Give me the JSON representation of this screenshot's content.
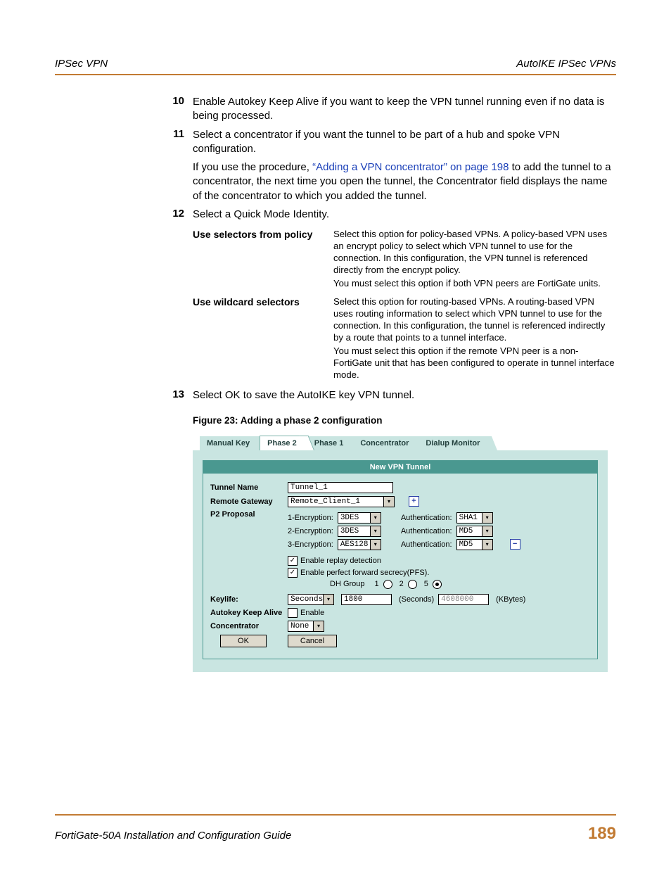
{
  "header": {
    "left": "IPSec VPN",
    "right": "AutoIKE IPSec VPNs"
  },
  "steps": {
    "s10": {
      "num": "10",
      "text": "Enable Autokey Keep Alive if you want to keep the VPN tunnel running even if no data is being processed."
    },
    "s11": {
      "num": "11",
      "text": "Select a concentrator if you want the tunnel to be part of a hub and spoke VPN configuration.",
      "note_pre": "If you use the procedure, ",
      "note_link": "“Adding a VPN concentrator” on page 198",
      "note_post": " to add the tunnel to a concentrator, the next time you open the tunnel, the Concentrator field displays the name of the concentrator to which you added the tunnel."
    },
    "s12": {
      "num": "12",
      "text": "Select a Quick Mode Identity."
    },
    "s13": {
      "num": "13",
      "text": "Select OK to save the AutoIKE key VPN tunnel."
    }
  },
  "options": {
    "r1": {
      "label": "Use selectors from policy",
      "p1": "Select this option for policy-based VPNs. A policy-based VPN uses an encrypt policy to select which VPN tunnel to use for the connection. In this configuration, the VPN tunnel is referenced directly from the encrypt policy.",
      "p2": "You must select this option if both VPN peers are FortiGate units."
    },
    "r2": {
      "label": "Use wildcard selectors",
      "p1": "Select this option for routing-based VPNs. A routing-based VPN uses routing information to select which VPN tunnel to use for the connection. In this configuration, the tunnel is referenced indirectly by a route that points to a tunnel interface.",
      "p2": "You must select this option if the remote VPN peer is a non-FortiGate unit that has been configured to operate in tunnel interface mode."
    }
  },
  "figure_caption": "Figure 23: Adding a phase 2 configuration",
  "ui": {
    "tabs": {
      "t1": "Manual Key",
      "t2": "Phase 2",
      "t3": "Phase 1",
      "t4": "Concentrator",
      "t5": "Dialup Monitor"
    },
    "panel_title": "New VPN Tunnel",
    "labels": {
      "tunnel_name": "Tunnel Name",
      "remote_gateway": "Remote Gateway",
      "p2_proposal": "P2 Proposal",
      "keylife": "Keylife:",
      "autokey": "Autokey Keep Alive",
      "concentrator": "Concentrator",
      "ok": "OK",
      "cancel": "Cancel",
      "enable": "Enable",
      "replay": "Enable replay detection",
      "pfs": "Enable perfect forward secrecy(PFS).",
      "dh_group": "DH Group",
      "enc_prefix1": "1-Encryption:",
      "enc_prefix2": "2-Encryption:",
      "enc_prefix3": "3-Encryption:",
      "auth_label": "Authentication:",
      "seconds_unit": "(Seconds)",
      "kbytes_unit": "(KBytes)"
    },
    "values": {
      "tunnel_name": "Tunnel_1",
      "remote_gateway": "Remote_Client_1",
      "enc1": "3DES",
      "auth1": "SHA1",
      "enc2": "3DES",
      "auth2": "MD5",
      "enc3": "AES128",
      "auth3": "MD5",
      "dh1": "1",
      "dh2": "2",
      "dh5": "5",
      "keylife_unit": "Seconds",
      "keylife_seconds": "1800",
      "keylife_kbytes": "4608000",
      "concentrator": "None",
      "plus": "+",
      "minus": "−",
      "check": "✓",
      "caret": "▾"
    }
  },
  "footer": {
    "title": "FortiGate-50A Installation and Configuration Guide",
    "page": "189"
  }
}
